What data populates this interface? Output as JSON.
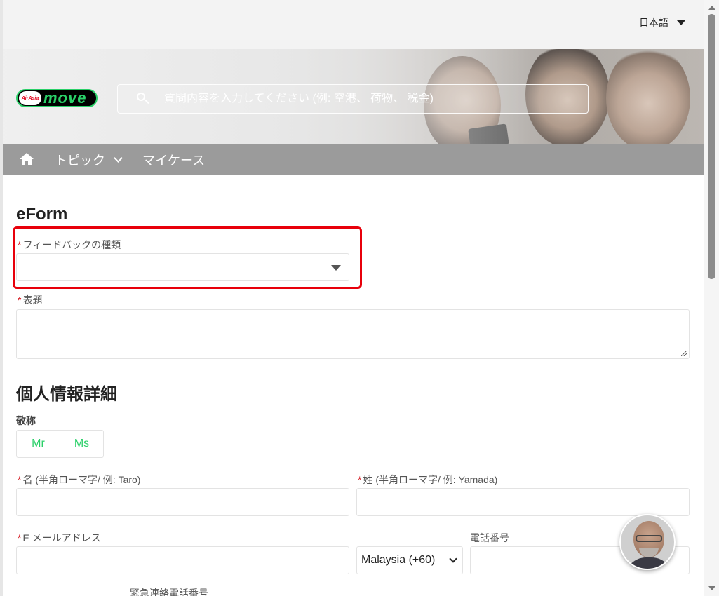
{
  "header": {
    "language_label": "日本語"
  },
  "brand": {
    "badge_text": "AirAsia",
    "word": "move"
  },
  "search": {
    "placeholder": "質問内容を入力してください (例: 空港、 荷物、 税金)"
  },
  "nav": {
    "topics_label": "トピック",
    "my_cases_label": "マイケース"
  },
  "form": {
    "title": "eForm",
    "required_marker": "*",
    "feedback_type_label": "フィードバックの種類",
    "feedback_type_value": "",
    "subject_label": "表題",
    "personal_section_title": "個人情報詳細",
    "salutation_label": "敬称",
    "salutation_options": [
      "Mr",
      "Ms"
    ],
    "first_name_label": "名 (半角ローマ字/ 例: Taro)",
    "last_name_label": "姓 (半角ローマ字/ 例: Yamada)",
    "email_label": "E メールアドレス",
    "phone_label": "電話番号",
    "country_code_value": "Malaysia (+60)",
    "emergency_phone_label": "緊急連絡電話番号"
  },
  "colors": {
    "accent_green": "#2ad068",
    "required_red": "#d4141c",
    "highlight_red": "#e8000b",
    "nav_bg": "#9b9b9b"
  },
  "icons": [
    "search-icon",
    "home-icon",
    "chevron-down-icon",
    "dropdown-arrow-icon",
    "resize-grip-icon"
  ]
}
